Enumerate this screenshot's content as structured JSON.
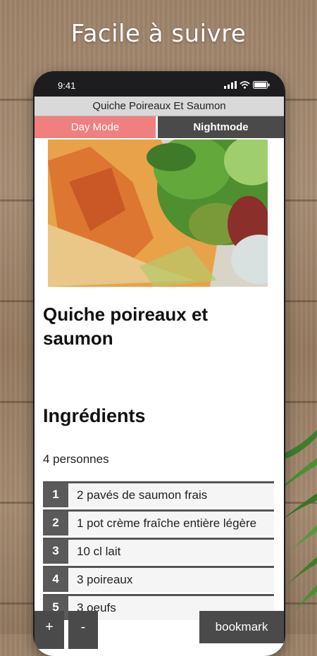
{
  "banner": {
    "text": "Facile à suivre"
  },
  "status": {
    "time": "9:41"
  },
  "app": {
    "title": "Quiche Poireaux Et Saumon",
    "day_mode": "Day Mode",
    "night_mode": "Nightmode"
  },
  "recipe": {
    "title": "Quiche poireaux et saumon",
    "section": "Ingrédients",
    "servings": "4 personnes",
    "ingredients": [
      {
        "num": "1",
        "text": "2 pavés de saumon frais"
      },
      {
        "num": "2",
        "text": "1 pot crème fraîche entière légère"
      },
      {
        "num": "3",
        "text": "10 cl lait"
      },
      {
        "num": "4",
        "text": "3 poireaux"
      },
      {
        "num": "5",
        "text": "3 oeufs"
      }
    ]
  },
  "controls": {
    "plus": "+",
    "minus": "-",
    "bookmark": "bookmark"
  },
  "colors": {
    "accent": "#f08080",
    "dark": "#4a4a4a"
  }
}
